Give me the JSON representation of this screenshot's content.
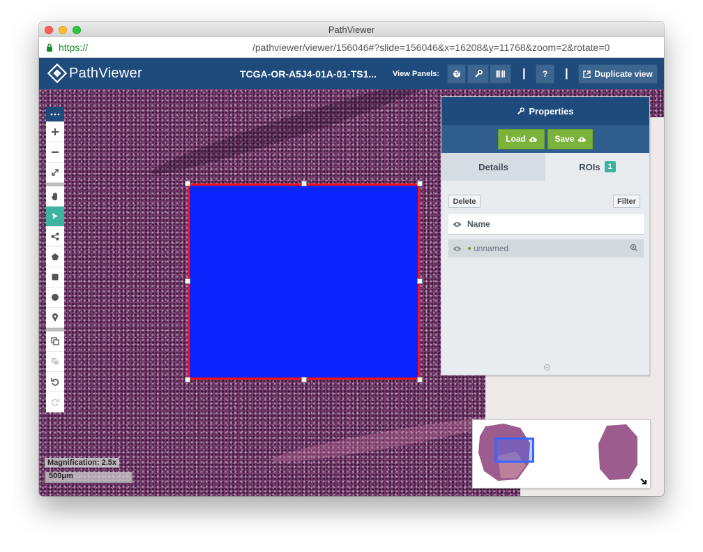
{
  "window": {
    "title": "PathViewer"
  },
  "url": {
    "scheme": "https://",
    "path": "/pathviewer/viewer/156046#?slide=156046&x=16208&y=11768&zoom=2&rotate=0"
  },
  "app": {
    "logo_text": "PathViewer",
    "slide_name": "TCGA-OR-A5J4-01A-01-TS1...",
    "view_panels_label": "View Panels:",
    "panel_buttons": [
      "globe-icon",
      "wrench-icon",
      "barcode-icon"
    ],
    "separator": "|",
    "help_label": "?",
    "duplicate_label": "Duplicate view"
  },
  "toolbar": {
    "tools": [
      "more-icon",
      "zoom-in-icon",
      "zoom-out-icon",
      "fit-icon",
      "pan-icon",
      "select-arrow-icon",
      "share-node-icon",
      "polygon-icon",
      "rectangle-icon",
      "circle-icon",
      "marker-icon",
      "copy-icon",
      "paste-icon",
      "undo-icon",
      "redo-icon"
    ],
    "active_tool": "select-arrow-icon"
  },
  "properties": {
    "title": "Properties",
    "load_label": "Load",
    "save_label": "Save",
    "tab_details": "Details",
    "tab_rois": "ROIs",
    "roi_count": "1",
    "delete_label": "Delete",
    "filter_label": "Filter",
    "column_name": "Name",
    "rows": [
      {
        "name": "unnamed"
      }
    ]
  },
  "status": {
    "magnification": "Magnification: 2.5x",
    "scale": "500μm"
  },
  "colors": {
    "header": "#1e4b7c",
    "accent_teal": "#3cb4a0",
    "button_green": "#7ab23a",
    "roi_fill": "#0b24fb",
    "roi_border": "#ff1111"
  }
}
